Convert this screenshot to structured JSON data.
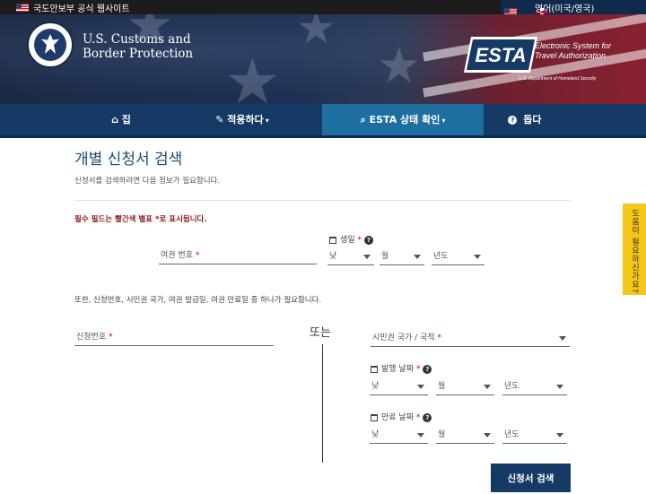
{
  "topbar": {
    "official_site": "국도안보부 공식 웹사이트",
    "language": "영어(미국/영국)"
  },
  "header": {
    "agency_line1": "U.S. Customs and",
    "agency_line2": "Border Protection",
    "esta_logo": "ESTA",
    "esta_full_line1": "Electronic System for",
    "esta_full_line2": "Travel Authorization",
    "esta_dept": "U.S. Department of Homeland Security",
    "seal_text": "U.S. DEPARTMENT OF HOMELAND SECURITY"
  },
  "nav": {
    "home": "집",
    "apply": "적용하다",
    "status": "ESTA 상태 확인",
    "help": "돕다",
    "active": "status"
  },
  "page": {
    "title": "개별 신청서 검색",
    "subtitle": "신청서를 검색하려면 다음 정보가 필요합니다.",
    "required_note": "필수 필드는 빨간색 별표 *로 표시됩니다.",
    "also_note": "또한, 신청번호, 시민권 국가, 여권 발급일, 여권 만료일 중 하나가 필요합니다.",
    "or_label": "또는",
    "search_button": "신청서 검색"
  },
  "form": {
    "passport_label": "여권 번호",
    "birth_label": "생일",
    "birth_day": "낮",
    "birth_month": "월",
    "birth_year": "년도",
    "app_number_label": "신청번호",
    "citizenship_label": "시민권 국가 / 국적",
    "issue_label": "발행 날짜",
    "issue_day": "낮",
    "issue_month": "월",
    "issue_year": "년도",
    "expiry_label": "만료 날짜",
    "expiry_day": "낮",
    "expiry_month": "월",
    "expiry_year": "년도",
    "required_mark": "*",
    "help_glyph": "?"
  },
  "help_tab": "도움이 필요하신가요?",
  "colors": {
    "nav_bg": "#163a66",
    "nav_active": "#1f6ea0",
    "title": "#1a4a7a",
    "required": "#8b1a1a",
    "help_tab": "#f5c518"
  }
}
